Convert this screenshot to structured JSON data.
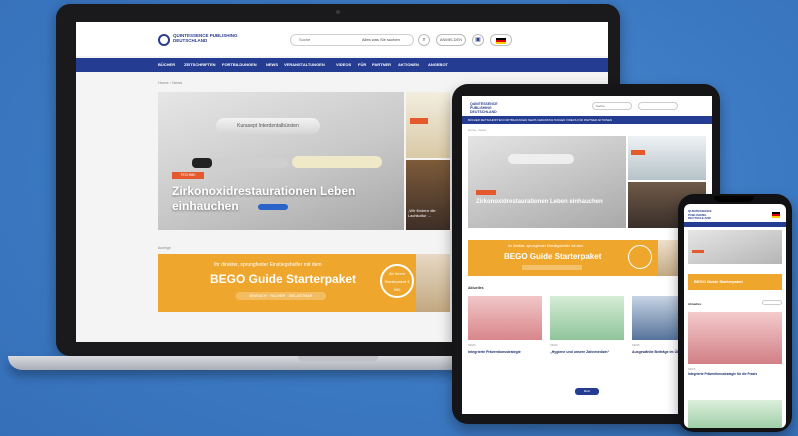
{
  "site": {
    "logo_text": "QUINTESSENCE PUBLISHING DEUTSCHLAND",
    "search_placeholder": "Suche",
    "search_scope": "Alles was Sie suchen",
    "login_label": "ANMELDEN",
    "nav_items": [
      "BÜCHER",
      "ZEITSCHRIFTEN",
      "FORTBILDUNGEN",
      "NEWS",
      "VERANSTALTUNGEN",
      "VIDEOS",
      "FÜR",
      "PARTNER",
      "AKTIONEN",
      "ANGEBOT"
    ],
    "breadcrumb": "Home › News",
    "hero_tag": "TECHNIK",
    "hero_case_label": "Kurasept Interdentalbürsten",
    "hero_title": "Zirkonoxidrestaurationen Leben einhauchen",
    "side_caption": "„Wir fördern die Lachkultur …",
    "ad_label": "Anzeige",
    "banner_subtitle": "Ihr direkter, sprungfester Einstiegshelfer mit dem",
    "banner_title": "BEGO Guide Starterpaket",
    "banner_cta": "EINFACH · SICHER · BELASTBAR",
    "banner_badge": "Ab Ihrem Starterpaket € 590"
  },
  "tablet": {
    "logo_text": "QUINTESSENCE PUBLISHING DEUTSCHLAND",
    "search_placeholder": "Suche",
    "nav_text": "BÜCHER  ZEITSCHRIFTEN  FORTBILDUNGEN  NEWS  VERANSTALTUNGEN  VIDEOS  FÜR  PARTNER  AKTIONEN",
    "breadcrumb": "Home › News",
    "hero_title": "Zirkonoxidrestaurationen Leben einhauchen",
    "banner_subtitle": "Ihr direkter, sprungfester Einstiegshelfer mit dem",
    "banner_title": "BEGO Guide Starterpaket",
    "section_title": "Aktuelles",
    "cards": [
      {
        "meta": "NEWS",
        "title": "Integrierte Präventionsstrategie"
      },
      {
        "meta": "NEWS",
        "title": "„Hygiene und unsere Zahnmedizin“"
      },
      {
        "meta": "NEWS",
        "title": "Ausgewählte Beiträge im Überblick"
      }
    ],
    "more_label": "Mehr"
  },
  "phone": {
    "logo_text": "QUINTESSENCE PUBLISHING DEUTSCHLAND",
    "banner_title": "BEGO Guide Starterpaket",
    "section_title": "Aktuelles",
    "card_meta": "NEWS",
    "card_title": "Integrierte Präventionsstrategie für die Praxis"
  },
  "colors": {
    "background": "#3f7ec9",
    "nav_blue": "#243c91",
    "banner_orange": "#efa62c",
    "tag_orange": "#e55a2c"
  }
}
